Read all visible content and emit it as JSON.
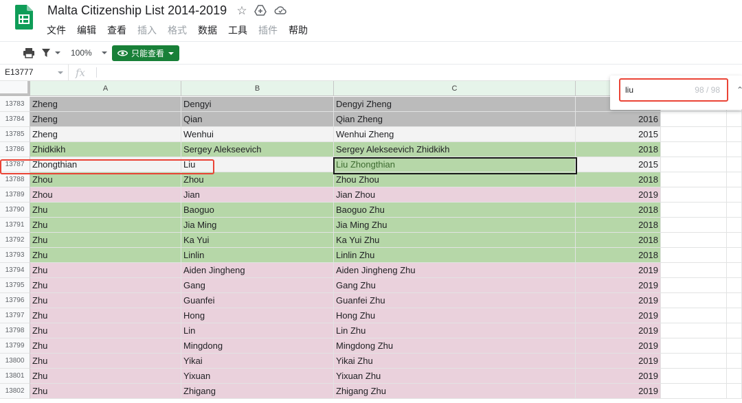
{
  "title": "Malta Citizenship List 2014-2019",
  "menu": [
    "文件",
    "编辑",
    "查看",
    "插入",
    "格式",
    "数据",
    "工具",
    "插件",
    "帮助"
  ],
  "menu_disabled": [
    false,
    false,
    false,
    true,
    true,
    false,
    false,
    true,
    false
  ],
  "toolbar": {
    "zoom": "100%",
    "view_only_label": "只能查看"
  },
  "formula_bar": {
    "cell_ref": "E13777",
    "fx": "fx"
  },
  "columns": [
    "A",
    "B",
    "C"
  ],
  "find": {
    "query": "liu",
    "count": "98 / 98"
  },
  "colors": {
    "green": "#b6d7a8",
    "pink": "#ead1dc",
    "gray": "#bbbbbb",
    "light_gray": "#f3f3f3",
    "highlight_red": "#ea4335"
  },
  "rows": [
    {
      "num": "13783",
      "a": "Zheng",
      "b": "Dengyi",
      "c": "Dengyi Zheng",
      "year": "",
      "color": "gray"
    },
    {
      "num": "13784",
      "a": "Zheng",
      "b": "Qian",
      "c": "Qian Zheng",
      "year": "2016",
      "color": "gray"
    },
    {
      "num": "13785",
      "a": "Zheng",
      "b": "Wenhui",
      "c": "Wenhui Zheng",
      "year": "2015",
      "color": "light_gray"
    },
    {
      "num": "13786",
      "a": "Zhidkikh",
      "b": "Sergey Alekseevich",
      "c": "Sergey Alekseevich Zhidkikh",
      "year": "2018",
      "color": "green"
    },
    {
      "num": "13787",
      "a": "Zhongthian",
      "b": "Liu",
      "c": "Liu Zhongthian",
      "year": "2015",
      "color": "light_gray"
    },
    {
      "num": "13788",
      "a": "Zhou",
      "b": "Zhou",
      "c": "Zhou Zhou",
      "year": "2018",
      "color": "green"
    },
    {
      "num": "13789",
      "a": "Zhou",
      "b": "Jian",
      "c": "Jian Zhou",
      "year": "2019",
      "color": "pink"
    },
    {
      "num": "13790",
      "a": "Zhu",
      "b": "Baoguo",
      "c": "Baoguo Zhu",
      "year": "2018",
      "color": "green"
    },
    {
      "num": "13791",
      "a": "Zhu",
      "b": "Jia Ming",
      "c": "Jia Ming Zhu",
      "year": "2018",
      "color": "green"
    },
    {
      "num": "13792",
      "a": "Zhu",
      "b": "Ka Yui",
      "c": "Ka Yui Zhu",
      "year": "2018",
      "color": "green"
    },
    {
      "num": "13793",
      "a": "Zhu",
      "b": "Linlin",
      "c": "Linlin Zhu",
      "year": "2018",
      "color": "green"
    },
    {
      "num": "13794",
      "a": "Zhu",
      "b": "Aiden Jingheng",
      "c": "Aiden Jingheng Zhu",
      "year": "2019",
      "color": "pink"
    },
    {
      "num": "13795",
      "a": "Zhu",
      "b": "Gang",
      "c": "Gang Zhu",
      "year": "2019",
      "color": "pink"
    },
    {
      "num": "13796",
      "a": "Zhu",
      "b": "Guanfei",
      "c": "Guanfei Zhu",
      "year": "2019",
      "color": "pink"
    },
    {
      "num": "13797",
      "a": "Zhu",
      "b": "Hong",
      "c": "Hong Zhu",
      "year": "2019",
      "color": "pink"
    },
    {
      "num": "13798",
      "a": "Zhu",
      "b": "Lin",
      "c": "Lin Zhu",
      "year": "2019",
      "color": "pink"
    },
    {
      "num": "13799",
      "a": "Zhu",
      "b": "Mingdong",
      "c": "Mingdong Zhu",
      "year": "2019",
      "color": "pink"
    },
    {
      "num": "13800",
      "a": "Zhu",
      "b": "Yikai",
      "c": "Yikai Zhu",
      "year": "2019",
      "color": "pink"
    },
    {
      "num": "13801",
      "a": "Zhu",
      "b": "Yixuan",
      "c": "Yixuan Zhu",
      "year": "2019",
      "color": "pink"
    },
    {
      "num": "13802",
      "a": "Zhu",
      "b": "Zhigang",
      "c": "Zhigang Zhu",
      "year": "2019",
      "color": "pink"
    }
  ]
}
